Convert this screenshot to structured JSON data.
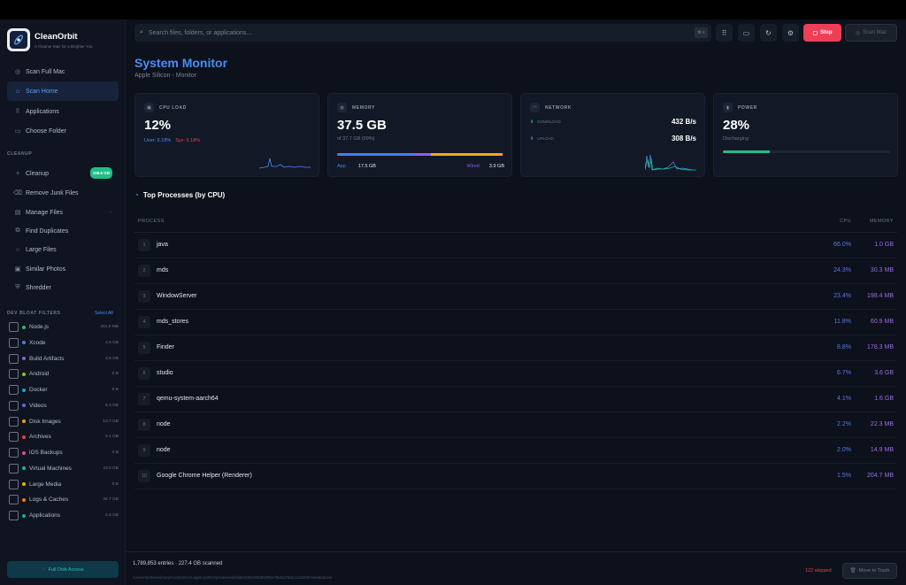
{
  "app": {
    "name": "CleanOrbit",
    "tagline": "A Cleaner Mac for a Brighter You"
  },
  "sidebar": {
    "nav": [
      {
        "label": "Scan Full Mac",
        "icon": "target-icon"
      },
      {
        "label": "Scan Home",
        "icon": "home-icon",
        "active": true
      },
      {
        "label": "Applications",
        "icon": "grid-icon"
      },
      {
        "label": "Choose Folder",
        "icon": "folder-icon"
      }
    ],
    "cleanup_title": "CLEANUP",
    "cleanup": [
      {
        "label": "Cleanup",
        "badge": "108.6 GB"
      },
      {
        "label": "Remove Junk Files"
      },
      {
        "label": "Manage Files",
        "chevron": "›"
      },
      {
        "label": "Find Duplicates"
      },
      {
        "label": "Large Files"
      },
      {
        "label": "Similar Photos"
      },
      {
        "label": "Shredder"
      }
    ],
    "dev_title": "DEV BLOAT FILTERS",
    "select_all": "Select All",
    "filters": [
      {
        "label": "Node.js",
        "size": "401.9 MB",
        "color": "#22c55e"
      },
      {
        "label": "Xcode",
        "size": "4.6 GB",
        "color": "#3b82f6"
      },
      {
        "label": "Build Artifacts",
        "size": "4.8 GB",
        "color": "#8b5cf6"
      },
      {
        "label": "Android",
        "size": "0 B",
        "color": "#84cc16"
      },
      {
        "label": "Docker",
        "size": "5 B",
        "color": "#0ea5e9"
      },
      {
        "label": "Videos",
        "size": "6.4 GB",
        "color": "#6366f1"
      },
      {
        "label": "Disk Images",
        "size": "13.7 GB",
        "color": "#f59e0b"
      },
      {
        "label": "Archives",
        "size": "9.1 GB",
        "color": "#ef4444"
      },
      {
        "label": "iOS Backups",
        "size": "0 B",
        "color": "#ec4899"
      },
      {
        "label": "Virtual Machines",
        "size": "23.0 GB",
        "color": "#14b8a6"
      },
      {
        "label": "Large Media",
        "size": "0 B",
        "color": "#eab308"
      },
      {
        "label": "Logs & Caches",
        "size": "34.7 GB",
        "color": "#f97316"
      },
      {
        "label": "Applications",
        "size": "4.6 GB",
        "color": "#10b981"
      }
    ],
    "full_disk": "Full Disk Access"
  },
  "toolbar": {
    "search_placeholder": "Search files, folders, or applications...",
    "shortcut": "⌘ K",
    "stop": "Stop",
    "scan_mac": "Scan Mac"
  },
  "page": {
    "title": "System Monitor",
    "subtitle": "Apple Silicon - Monitor"
  },
  "cards": {
    "cpu": {
      "label": "CPU LOAD",
      "value": "12%",
      "user": "User: 6.18%",
      "sys": "Sys: 6.18%"
    },
    "memory": {
      "label": "MEMORY",
      "value": "37.5 GB",
      "sub": "of 37.7 GB (99%)",
      "app_label": "App",
      "app_value": "17.5 GB",
      "wired_label": "Wired",
      "wired_value": "3.9 GB",
      "app_fraction": 0.46,
      "wired_fraction": 0.1,
      "used_fraction": 0.99
    },
    "network": {
      "label": "NETWORK",
      "down_label": "DOWNLOAD",
      "down": "432 B/s",
      "up_label": "UPLOAD",
      "up": "308 B/s"
    },
    "power": {
      "label": "POWER",
      "value": "28%",
      "sub": "Discharging",
      "fraction": 0.28
    }
  },
  "processes": {
    "title": "Top Processes (by CPU)",
    "col_process": "PROCESS",
    "col_cpu": "CPU",
    "col_memory": "MEMORY",
    "rows": [
      {
        "n": "1",
        "name": "java",
        "cpu": "66.0%",
        "mem": "1.0 GB"
      },
      {
        "n": "2",
        "name": "mds",
        "cpu": "24.3%",
        "mem": "30.3 MB"
      },
      {
        "n": "3",
        "name": "WindowServer",
        "cpu": "23.4%",
        "mem": "198.4 MB"
      },
      {
        "n": "4",
        "name": "mds_stores",
        "cpu": "11.8%",
        "mem": "60.9 MB"
      },
      {
        "n": "5",
        "name": "Finder",
        "cpu": "8.8%",
        "mem": "178.3 MB"
      },
      {
        "n": "6",
        "name": "studio",
        "cpu": "6.7%",
        "mem": "3.6 GB"
      },
      {
        "n": "7",
        "name": "qemu-system-aarch64",
        "cpu": "4.1%",
        "mem": "1.6 GB"
      },
      {
        "n": "8",
        "name": "node",
        "cpu": "2.2%",
        "mem": "22.3 MB"
      },
      {
        "n": "9",
        "name": "node",
        "cpu": "2.0%",
        "mem": "14.9 MB"
      },
      {
        "n": "10",
        "name": "Google Chrome Helper (Renderer)",
        "cpu": "1.5%",
        "mem": "204.7 MB"
      }
    ]
  },
  "footer": {
    "status": "1,789,853 entries · 227.4 GB scanned",
    "path": "/Users/andrew/Library/Caches/com.apple.python/private/var/folders/5t/e0363f5d0be7fbd167bdcc11602f0/metadata.bin",
    "skipped": "122 skipped",
    "move_to_trash": "Move to Trash"
  },
  "colors": {
    "accent": "#4b8df6",
    "stop": "#ef3f57",
    "green": "#1fbf85",
    "purple": "#a06ae8"
  }
}
